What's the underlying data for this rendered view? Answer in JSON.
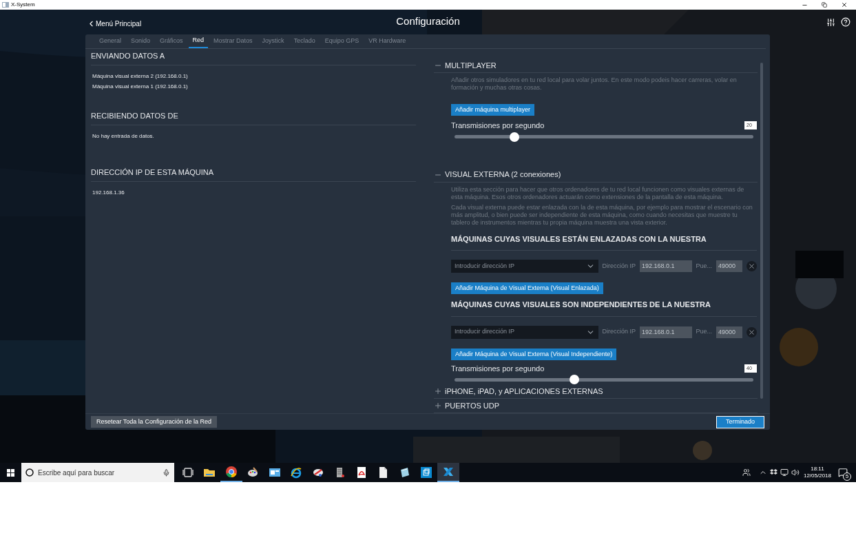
{
  "window": {
    "title": "X-System"
  },
  "header": {
    "back": "Menú Principal",
    "title": "Configuración"
  },
  "tabs": [
    {
      "label": "General",
      "selected": false
    },
    {
      "label": "Sonido",
      "selected": false
    },
    {
      "label": "Gráficos",
      "selected": false
    },
    {
      "label": "Red",
      "selected": true
    },
    {
      "label": "Mostrar Datos",
      "selected": false
    },
    {
      "label": "Joystick",
      "selected": false
    },
    {
      "label": "Teclado",
      "selected": false
    },
    {
      "label": "Equipo GPS",
      "selected": false
    },
    {
      "label": "VR Hardware",
      "selected": false
    }
  ],
  "left_sections": [
    {
      "heading": "ENVIANDO DATOS A",
      "items": [
        "Máquina visual externa 2 (192.168.0.1)",
        "Máquina visual externa 1 (192.168.0.1)"
      ]
    },
    {
      "heading": "RECIBIENDO DATOS DE",
      "items": [
        "No hay entrada de datos."
      ]
    },
    {
      "heading": "DIRECCIÓN IP DE ESTA MÁQUINA",
      "items": [
        "192.168.1.36"
      ]
    }
  ],
  "right_sections": [
    {
      "title": "MULTIPLAYER",
      "expanded": true,
      "paragraphs": [
        "Añadir otros simuladores en tu red local para volar juntos. En este modo podeis hacer carreras, volar en formación y muchas otras cosas."
      ],
      "button": "Añadir máquina multiplayer",
      "rate": {
        "label": "Transmisiones por segundo",
        "value": "20",
        "level": 0.2
      }
    },
    {
      "title": "VISUAL EXTERNA (2 conexiones)",
      "expanded": true,
      "paragraphs": [
        "Utiliza esta sección para hacer que otros ordenadores de tu red local funcionen como visuales externas de esta máquina. Esos otros ordenadores actuarán como extensiones de la pantalla de esta máquina.",
        "Cada visual externa puede estar enlazada con la de esta máquina, por ejemplo para mostrar el escenario con más amplitud, o bien puede ser independiente de esta máquina, como cuando necesitas que muestre tu tablero de instrumentos mientras tu propia máquina muestra una vista exterior."
      ],
      "groups": [
        {
          "heading": "MÁQUINAS CUYAS VISUALES ESTÁN ENLAZADAS CON LA NUESTRA",
          "select_placeholder": "Introducir dirección IP",
          "ip_label": "Dirección IP",
          "ip_value": "192.168.0.1",
          "port_label": "Pue...",
          "port_value": "49000",
          "button": "Añadir Máquina de Visual Externa (Visual Enlazada)"
        },
        {
          "heading": "MÁQUINAS CUYAS VISUALES SON INDEPENDIENTES DE LA NUESTRA",
          "select_placeholder": "Introducir dirección IP",
          "ip_label": "Dirección IP",
          "ip_value": "192.168.0.1",
          "port_label": "Pue...",
          "port_value": "49000",
          "button": "Añadir Máquina de Visual Externa (Visual Independiente)"
        }
      ],
      "rate": {
        "label": "Transmisiones por segundo",
        "value": "40",
        "level": 0.4
      }
    },
    {
      "title": "iPHONE, iPAD, y APLICACIONES EXTERNAS",
      "expanded": false
    },
    {
      "title": "PUERTOS UDP",
      "expanded": false
    }
  ],
  "footer": {
    "reset": "Resetear Toda la Configuración de la Red",
    "done": "Terminado"
  },
  "taskbar": {
    "search_placeholder": "Escribe aquí para buscar",
    "apps": [
      {
        "kind": "taskview",
        "running": false,
        "selected": false
      },
      {
        "kind": "folder",
        "running": false,
        "selected": false
      },
      {
        "kind": "chrome",
        "running": true,
        "selected": false
      },
      {
        "kind": "paint",
        "running": false,
        "selected": false
      },
      {
        "kind": "window",
        "running": false,
        "selected": false
      },
      {
        "kind": "ie",
        "running": false,
        "selected": false
      },
      {
        "kind": "tools",
        "running": false,
        "selected": false
      },
      {
        "kind": "server",
        "running": false,
        "selected": false
      },
      {
        "kind": "pdf",
        "running": false,
        "selected": false
      },
      {
        "kind": "file",
        "running": false,
        "selected": false
      },
      {
        "kind": "notes",
        "running": false,
        "selected": false
      },
      {
        "kind": "store",
        "running": false,
        "selected": false
      },
      {
        "kind": "xplane",
        "running": true,
        "selected": true
      }
    ],
    "time": "18:11",
    "date": "12/05/2018",
    "notifications": "5"
  }
}
